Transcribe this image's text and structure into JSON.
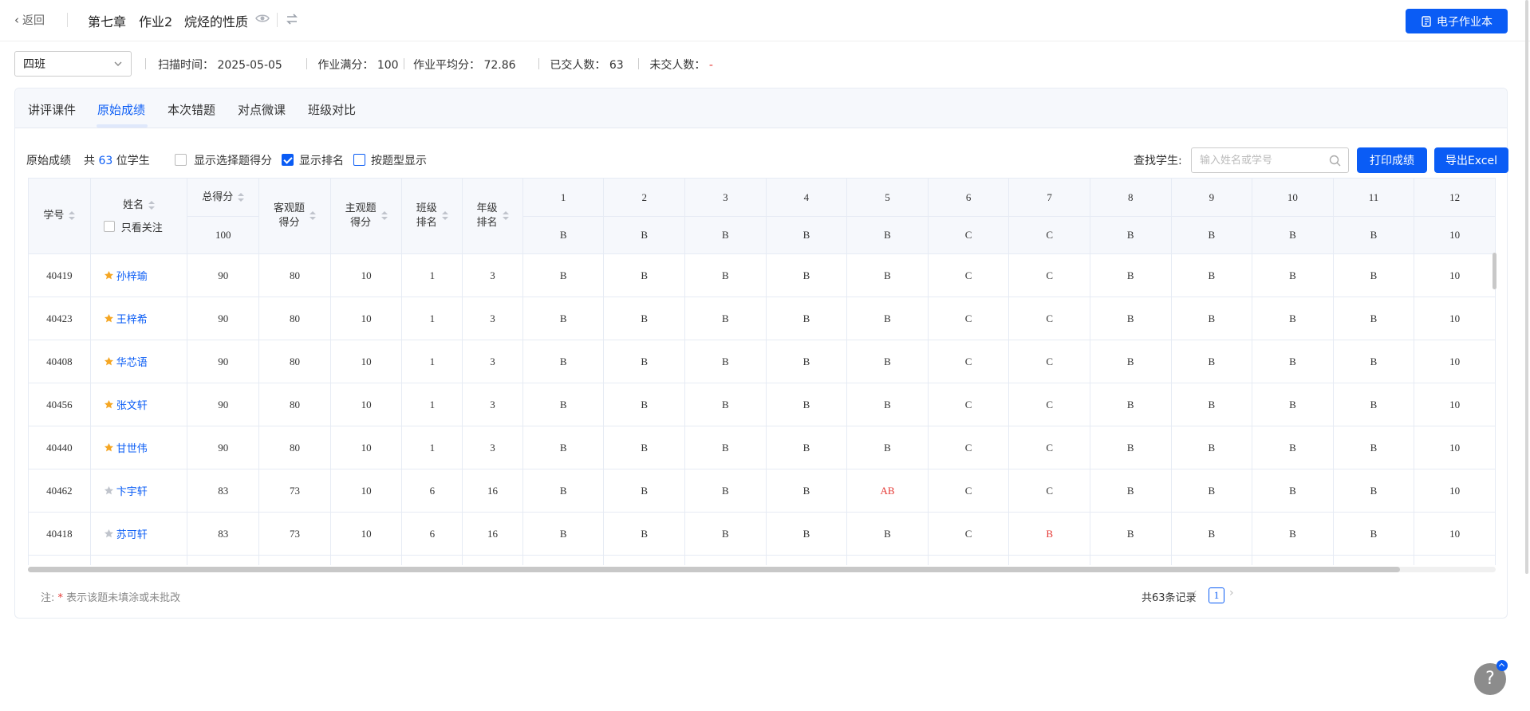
{
  "header": {
    "back_label": "返回",
    "chapter": "第七章",
    "assignment": "作业2",
    "topic": "烷烃的性质",
    "ebook_button": "电子作业本"
  },
  "info": {
    "class_selected": "四班",
    "scan_time_label": "扫描时间：",
    "scan_time": "2025-05-05",
    "full_score_label": "作业满分：",
    "full_score": "100",
    "avg_label": "作业平均分：",
    "avg": "72.86",
    "submitted_label": "已交人数：",
    "submitted": "63",
    "not_submitted_label": "未交人数：",
    "not_submitted": "-"
  },
  "tabs": [
    "讲评课件",
    "原始成绩",
    "本次错题",
    "对点微课",
    "班级对比"
  ],
  "toolbar": {
    "title": "原始成绩",
    "count_prefix": "共",
    "count": "63",
    "count_suffix": "位学生",
    "opt_choice_score": "显示选择题得分",
    "opt_rank": "显示排名",
    "opt_by_type": "按题型显示",
    "search_label": "查找学生:",
    "search_placeholder": "输入姓名或学号",
    "print_button": "打印成绩",
    "export_button": "导出Excel"
  },
  "table": {
    "headers": {
      "student_id": "学号",
      "name": "姓名",
      "follow_only": "只看关注",
      "total": "总得分",
      "total_full": "100",
      "objective_l1": "客观题",
      "objective_l2": "得分",
      "subjective_l1": "主观题",
      "subjective_l2": "得分",
      "class_rank_l1": "班级",
      "class_rank_l2": "排名",
      "grade_rank_l1": "年级",
      "grade_rank_l2": "排名"
    },
    "questions": [
      "1",
      "2",
      "3",
      "4",
      "5",
      "6",
      "7",
      "8",
      "9",
      "10",
      "11",
      "12"
    ],
    "answer_key": [
      "B",
      "B",
      "B",
      "B",
      "B",
      "C",
      "C",
      "B",
      "B",
      "B",
      "B",
      "10"
    ],
    "rows": [
      {
        "id": "40419",
        "name": "孙梓瑜",
        "starred": true,
        "total": "90",
        "obj": "80",
        "subj": "10",
        "class_rank": "1",
        "grade_rank": "3",
        "answers": [
          "B",
          "B",
          "B",
          "B",
          "B",
          "C",
          "C",
          "B",
          "B",
          "B",
          "B",
          "10"
        ],
        "wrong": []
      },
      {
        "id": "40423",
        "name": "王梓希",
        "starred": true,
        "total": "90",
        "obj": "80",
        "subj": "10",
        "class_rank": "1",
        "grade_rank": "3",
        "answers": [
          "B",
          "B",
          "B",
          "B",
          "B",
          "C",
          "C",
          "B",
          "B",
          "B",
          "B",
          "10"
        ],
        "wrong": []
      },
      {
        "id": "40408",
        "name": "华芯语",
        "starred": true,
        "total": "90",
        "obj": "80",
        "subj": "10",
        "class_rank": "1",
        "grade_rank": "3",
        "answers": [
          "B",
          "B",
          "B",
          "B",
          "B",
          "C",
          "C",
          "B",
          "B",
          "B",
          "B",
          "10"
        ],
        "wrong": []
      },
      {
        "id": "40456",
        "name": "张文轩",
        "starred": true,
        "total": "90",
        "obj": "80",
        "subj": "10",
        "class_rank": "1",
        "grade_rank": "3",
        "answers": [
          "B",
          "B",
          "B",
          "B",
          "B",
          "C",
          "C",
          "B",
          "B",
          "B",
          "B",
          "10"
        ],
        "wrong": []
      },
      {
        "id": "40440",
        "name": "甘世伟",
        "starred": true,
        "total": "90",
        "obj": "80",
        "subj": "10",
        "class_rank": "1",
        "grade_rank": "3",
        "answers": [
          "B",
          "B",
          "B",
          "B",
          "B",
          "C",
          "C",
          "B",
          "B",
          "B",
          "B",
          "10"
        ],
        "wrong": []
      },
      {
        "id": "40462",
        "name": "卞宇轩",
        "starred": false,
        "total": "83",
        "obj": "73",
        "subj": "10",
        "class_rank": "6",
        "grade_rank": "16",
        "answers": [
          "B",
          "B",
          "B",
          "B",
          "AB",
          "C",
          "C",
          "B",
          "B",
          "B",
          "B",
          "10"
        ],
        "wrong": [
          4
        ]
      },
      {
        "id": "40418",
        "name": "苏可轩",
        "starred": false,
        "total": "83",
        "obj": "73",
        "subj": "10",
        "class_rank": "6",
        "grade_rank": "16",
        "answers": [
          "B",
          "B",
          "B",
          "B",
          "B",
          "C",
          "B",
          "B",
          "B",
          "B",
          "B",
          "10"
        ],
        "wrong": [
          6
        ]
      }
    ]
  },
  "footer": {
    "note_prefix": "注:",
    "note_star": "*",
    "note_text": "表示该题未填涂或未批改",
    "total_records": "共63条记录",
    "current_page": "1"
  },
  "help_label": "?",
  "colors": {
    "primary": "#0a5cf5",
    "error": "#e53935",
    "star_on": "#f5a623",
    "star_off": "#c0c4cc"
  }
}
